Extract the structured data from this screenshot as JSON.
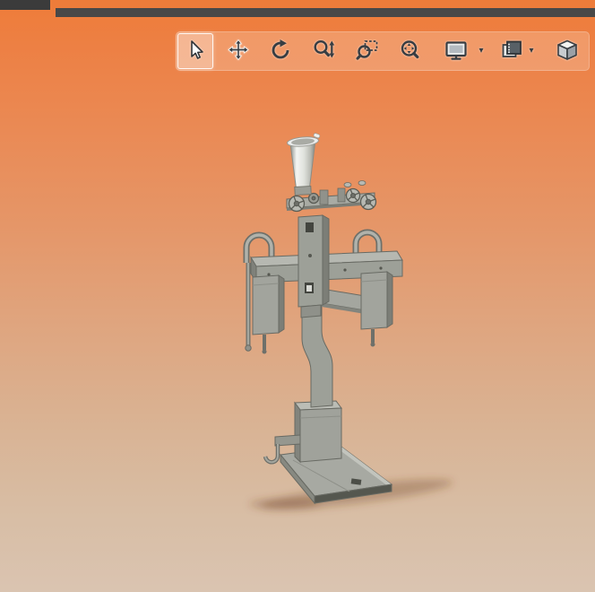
{
  "toolbar": {
    "dropdown_glyph": "▾",
    "tools": [
      {
        "id": "select",
        "icon": "cursor-arrow-icon",
        "selected": true
      },
      {
        "id": "pan",
        "icon": "pan-arrows-icon",
        "selected": false
      },
      {
        "id": "rotate-view",
        "icon": "rotate-arrows-icon",
        "selected": false
      },
      {
        "id": "zoom-in-out",
        "icon": "magnifier-arrow-icon",
        "selected": false
      },
      {
        "id": "zoom-to-area",
        "icon": "magnifier-area-icon",
        "selected": false
      },
      {
        "id": "zoom-to-fit",
        "icon": "magnifier-fit-icon",
        "selected": false
      },
      {
        "id": "display-style",
        "icon": "monitor-icon",
        "selected": false,
        "has_dropdown": true
      },
      {
        "id": "apply-scene",
        "icon": "scene-pages-icon",
        "selected": false,
        "has_dropdown": true
      },
      {
        "id": "view-orientation",
        "icon": "isometric-cube-icon",
        "selected": false
      }
    ]
  },
  "colors": {
    "background_top": "#ee7c39",
    "background_bottom": "#dac4b1",
    "titlebar_fragment": "#3b3b3b",
    "model_gray": "#a2a49d",
    "model_outline": "#686a63",
    "ground_shadow": "#6e3d1f"
  },
  "model": {
    "name": "gray-cad-assembly-with-funnel-crossbeam-and-base-platform"
  }
}
